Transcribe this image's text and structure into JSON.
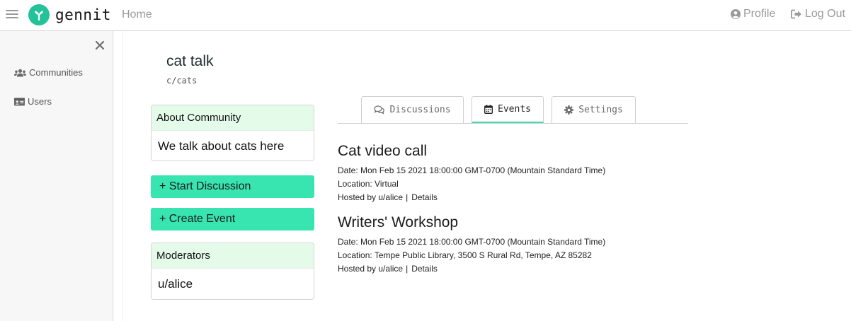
{
  "header": {
    "brand": "gennit",
    "home_label": "Home",
    "profile_label": "Profile",
    "logout_label": "Log Out",
    "accent": "#23c29a"
  },
  "sidebar": {
    "items": [
      {
        "label": "Communities",
        "icon": "users-icon"
      },
      {
        "label": "Users",
        "icon": "id-card-icon"
      }
    ]
  },
  "community": {
    "title": "cat talk",
    "slug": "c/cats",
    "about_heading": "About Community",
    "about_text": "We talk about cats here",
    "start_discussion_label": "+ Start Discussion",
    "create_event_label": "+ Create Event",
    "moderators_heading": "Moderators",
    "moderators": [
      "u/alice"
    ]
  },
  "tabs": [
    {
      "label": "Discussions",
      "icon": "comments-icon",
      "active": false
    },
    {
      "label": "Events",
      "icon": "calendar-icon",
      "active": true
    },
    {
      "label": "Settings",
      "icon": "gear-icon",
      "active": false
    }
  ],
  "events": [
    {
      "title": "Cat video call",
      "date": "Date: Mon Feb 15 2021 18:00:00 GMT-0700 (Mountain Standard Time)",
      "location": "Location: Virtual",
      "hosted_by": "Hosted by u/alice",
      "details_label": "Details"
    },
    {
      "title": "Writers' Workshop",
      "date": "Date: Mon Feb 15 2021 18:00:00 GMT-0700 (Mountain Standard Time)",
      "location": "Location: Tempe Public Library, 3500 S Rural Rd, Tempe, AZ 85282",
      "hosted_by": "Hosted by u/alice",
      "details_label": "Details"
    }
  ],
  "colors": {
    "button_green": "#38e4b0",
    "card_header_green": "#e4fbea",
    "active_tab_underline": "#3ddbb0"
  }
}
